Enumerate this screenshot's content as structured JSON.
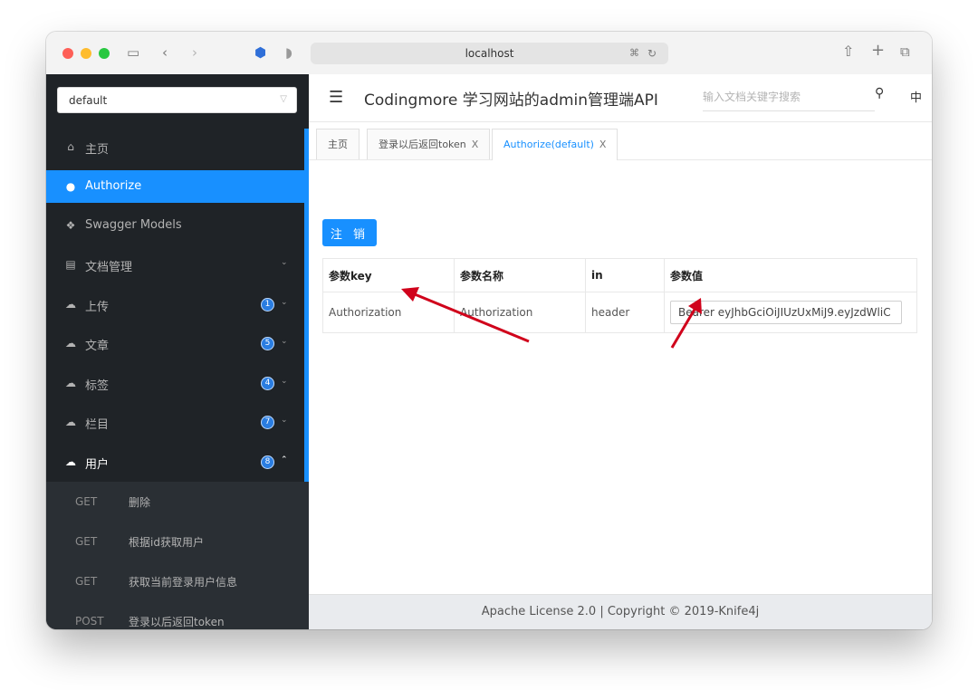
{
  "browser": {
    "url_host": "localhost"
  },
  "sidebar": {
    "group_select": "default",
    "menu": [
      {
        "label": "主页",
        "icon": "home-icon"
      },
      {
        "label": "Authorize",
        "icon": "lock-icon",
        "active": true
      },
      {
        "label": "Swagger Models",
        "icon": "cube-icon"
      },
      {
        "label": "文档管理",
        "icon": "document-icon"
      },
      {
        "label": "上传",
        "icon": "cloud-icon",
        "badge": "1"
      },
      {
        "label": "文章",
        "icon": "cloud-icon",
        "badge": "5"
      },
      {
        "label": "标签",
        "icon": "cloud-icon",
        "badge": "4"
      },
      {
        "label": "栏目",
        "icon": "cloud-icon",
        "badge": "7"
      },
      {
        "label": "用户",
        "icon": "cloud-icon",
        "badge": "8",
        "expanded": true
      }
    ],
    "sub_items": [
      {
        "method": "GET",
        "name": "删除"
      },
      {
        "method": "GET",
        "name": "根据id获取用户"
      },
      {
        "method": "GET",
        "name": "获取当前登录用户信息"
      },
      {
        "method": "POST",
        "name": "登录以后返回token"
      }
    ]
  },
  "header": {
    "title": "Codingmore 学习网站的admin管理端API",
    "search_placeholder": "输入文档关键字搜索",
    "lang": "中"
  },
  "tabs": [
    {
      "label": "主页"
    },
    {
      "label": "登录以后返回token",
      "closable": true
    },
    {
      "label": "Authorize(default)",
      "closable": true,
      "active": true
    }
  ],
  "close_glyph": "X",
  "authorize": {
    "logout_label": "注 销",
    "columns": [
      "参数key",
      "参数名称",
      "in",
      "参数值"
    ],
    "rows": [
      {
        "key": "Authorization",
        "name": "Authorization",
        "in": "header",
        "value": "Bearer eyJhbGciOiJIUzUxMiJ9.eyJzdWliC"
      }
    ]
  },
  "footer": {
    "text": "Apache License 2.0 | Copyright © 2019-Knife4j"
  },
  "colors": {
    "accent": "#1890ff",
    "sidebar_bg": "#1f2327",
    "annotation_arrow": "#d0021b"
  }
}
